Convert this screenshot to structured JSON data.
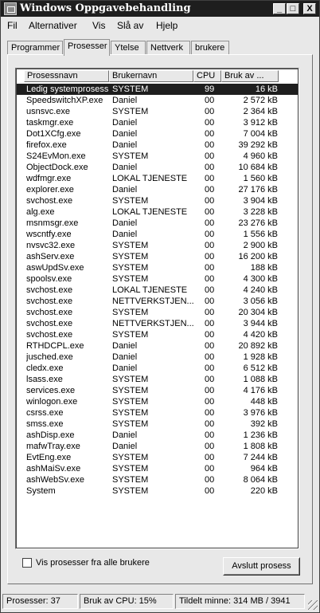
{
  "window": {
    "title": "Windows Oppgavebehandling",
    "min": "_",
    "max": "□",
    "close": "X"
  },
  "menu": [
    "Fil",
    "Alternativer",
    "Vis",
    "Slå av",
    "Hjelp"
  ],
  "tabs": [
    "Programmer",
    "Prosesser",
    "Ytelse",
    "Nettverk",
    "brukere"
  ],
  "active_tab": "Prosesser",
  "columns": [
    "Prosessnavn",
    "Brukernavn",
    "CPU",
    "Bruk av ..."
  ],
  "processes": [
    {
      "name": "Ledig systemprosess",
      "user": "SYSTEM",
      "cpu": "99",
      "mem": "16 kB",
      "selected": true
    },
    {
      "name": "SpeedswitchXP.exe",
      "user": "Daniel",
      "cpu": "00",
      "mem": "2 572 kB"
    },
    {
      "name": "usnsvc.exe",
      "user": "SYSTEM",
      "cpu": "00",
      "mem": "2 364 kB"
    },
    {
      "name": "taskmgr.exe",
      "user": "Daniel",
      "cpu": "00",
      "mem": "3 912 kB"
    },
    {
      "name": "Dot1XCfg.exe",
      "user": "Daniel",
      "cpu": "00",
      "mem": "7 004 kB"
    },
    {
      "name": "firefox.exe",
      "user": "Daniel",
      "cpu": "00",
      "mem": "39 292 kB"
    },
    {
      "name": "S24EvMon.exe",
      "user": "SYSTEM",
      "cpu": "00",
      "mem": "4 960 kB"
    },
    {
      "name": "ObjectDock.exe",
      "user": "Daniel",
      "cpu": "00",
      "mem": "10 684 kB"
    },
    {
      "name": "wdfmgr.exe",
      "user": "LOKAL TJENESTE",
      "cpu": "00",
      "mem": "1 560 kB"
    },
    {
      "name": "explorer.exe",
      "user": "Daniel",
      "cpu": "00",
      "mem": "27 176 kB"
    },
    {
      "name": "svchost.exe",
      "user": "SYSTEM",
      "cpu": "00",
      "mem": "3 904 kB"
    },
    {
      "name": "alg.exe",
      "user": "LOKAL TJENESTE",
      "cpu": "00",
      "mem": "3 228 kB"
    },
    {
      "name": "msnmsgr.exe",
      "user": "Daniel",
      "cpu": "00",
      "mem": "23 276 kB"
    },
    {
      "name": "wscntfy.exe",
      "user": "Daniel",
      "cpu": "00",
      "mem": "1 556 kB"
    },
    {
      "name": "nvsvc32.exe",
      "user": "SYSTEM",
      "cpu": "00",
      "mem": "2 900 kB"
    },
    {
      "name": "ashServ.exe",
      "user": "SYSTEM",
      "cpu": "00",
      "mem": "16 200 kB"
    },
    {
      "name": "aswUpdSv.exe",
      "user": "SYSTEM",
      "cpu": "00",
      "mem": "188 kB"
    },
    {
      "name": "spoolsv.exe",
      "user": "SYSTEM",
      "cpu": "00",
      "mem": "4 300 kB"
    },
    {
      "name": "svchost.exe",
      "user": "LOKAL TJENESTE",
      "cpu": "00",
      "mem": "4 240 kB"
    },
    {
      "name": "svchost.exe",
      "user": "NETTVERKSTJEN...",
      "cpu": "00",
      "mem": "3 056 kB"
    },
    {
      "name": "svchost.exe",
      "user": "SYSTEM",
      "cpu": "00",
      "mem": "20 304 kB"
    },
    {
      "name": "svchost.exe",
      "user": "NETTVERKSTJEN...",
      "cpu": "00",
      "mem": "3 944 kB"
    },
    {
      "name": "svchost.exe",
      "user": "SYSTEM",
      "cpu": "00",
      "mem": "4 420 kB"
    },
    {
      "name": "RTHDCPL.exe",
      "user": "Daniel",
      "cpu": "00",
      "mem": "20 892 kB"
    },
    {
      "name": "jusched.exe",
      "user": "Daniel",
      "cpu": "00",
      "mem": "1 928 kB"
    },
    {
      "name": "cledx.exe",
      "user": "Daniel",
      "cpu": "00",
      "mem": "6 512 kB"
    },
    {
      "name": "lsass.exe",
      "user": "SYSTEM",
      "cpu": "00",
      "mem": "1 088 kB"
    },
    {
      "name": "services.exe",
      "user": "SYSTEM",
      "cpu": "00",
      "mem": "4 176 kB"
    },
    {
      "name": "winlogon.exe",
      "user": "SYSTEM",
      "cpu": "00",
      "mem": "448 kB"
    },
    {
      "name": "csrss.exe",
      "user": "SYSTEM",
      "cpu": "00",
      "mem": "3 976 kB"
    },
    {
      "name": "smss.exe",
      "user": "SYSTEM",
      "cpu": "00",
      "mem": "392 kB"
    },
    {
      "name": "ashDisp.exe",
      "user": "Daniel",
      "cpu": "00",
      "mem": "1 236 kB"
    },
    {
      "name": "mafwTray.exe",
      "user": "Daniel",
      "cpu": "00",
      "mem": "1 808 kB"
    },
    {
      "name": "EvtEng.exe",
      "user": "SYSTEM",
      "cpu": "00",
      "mem": "7 244 kB"
    },
    {
      "name": "ashMaiSv.exe",
      "user": "SYSTEM",
      "cpu": "00",
      "mem": "964 kB"
    },
    {
      "name": "ashWebSv.exe",
      "user": "SYSTEM",
      "cpu": "00",
      "mem": "8 064 kB"
    },
    {
      "name": "System",
      "user": "SYSTEM",
      "cpu": "00",
      "mem": "220 kB"
    }
  ],
  "show_all_users_label": "Vis prosesser fra alle brukere",
  "end_process_label": "Avslutt prosess",
  "status": {
    "processes": "Prosesser: 37",
    "cpu": "Bruk av CPU: 15%",
    "memory": "Tildelt minne: 314 MB / 3941"
  }
}
